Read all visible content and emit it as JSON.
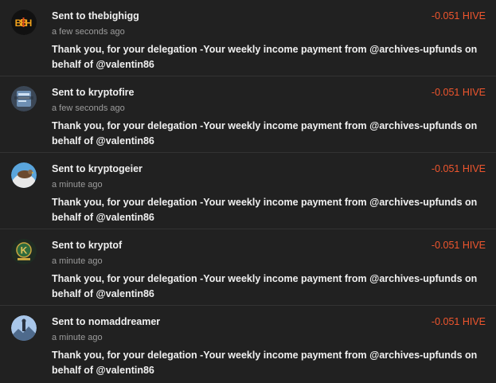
{
  "sent_prefix": "Sent to",
  "currency": "HIVE",
  "transactions": [
    {
      "recipient": "thebighigg",
      "time": "a few seconds ago",
      "amount": "-0.051 HIVE",
      "memo": "Thank you, for your delegation -Your weekly income payment from @archives-upfunds on behalf of @valentin86",
      "avatar": "bh-logo-icon"
    },
    {
      "recipient": "kryptofire",
      "time": "a few seconds ago",
      "amount": "-0.051 HIVE",
      "memo": "Thank you, for your delegation -Your weekly income payment from @archives-upfunds on behalf of @valentin86",
      "avatar": "kryptofire-avatar-icon"
    },
    {
      "recipient": "kryptogeier",
      "time": "a minute ago",
      "amount": "-0.051 HIVE",
      "memo": "Thank you, for your delegation -Your weekly income payment from @archives-upfunds on behalf of @valentin86",
      "avatar": "vulture-avatar-icon"
    },
    {
      "recipient": "kryptof",
      "time": "a minute ago",
      "amount": "-0.051 HIVE",
      "memo": "Thank you, for your delegation -Your weekly income payment from @archives-upfunds on behalf of @valentin86",
      "avatar": "kryptof-coin-icon"
    },
    {
      "recipient": "nomaddreamer",
      "time": "a minute ago",
      "amount": "-0.051 HIVE",
      "memo": "Thank you, for your delegation -Your weekly income payment from @archives-upfunds on behalf of @valentin86",
      "avatar": "mountain-avatar-icon"
    }
  ],
  "colors": {
    "background": "#212121",
    "amount": "#f0562e",
    "divider": "#333333"
  }
}
